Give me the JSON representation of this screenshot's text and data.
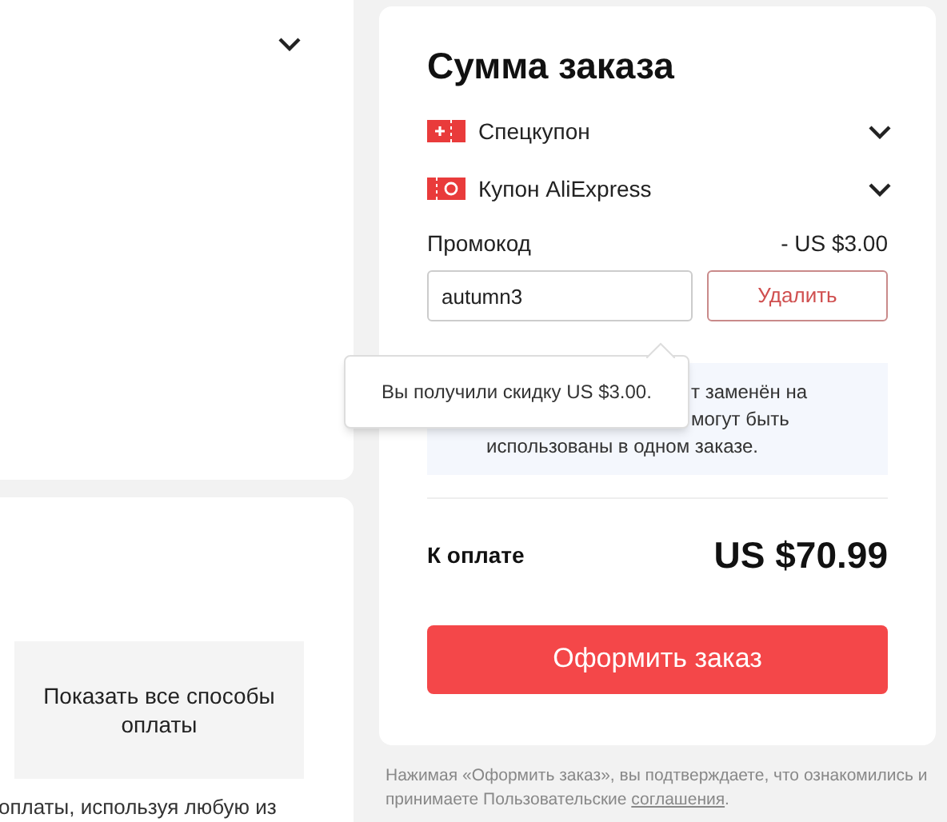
{
  "left_panel": {
    "show_payment_methods_button": "Показать все способы оплаты",
    "payment_note": "оплаты, используя любую из"
  },
  "order_summary": {
    "title": "Сумма заказа",
    "coupons": [
      {
        "kind": "special",
        "label": "Спецкупон"
      },
      {
        "kind": "store",
        "label": "Купон AliExpress"
      }
    ],
    "promo": {
      "label": "Промокод",
      "discount": "- US $3.00",
      "value": "autumn3",
      "remove_button": "Удалить"
    },
    "tooltip": "Вы получили скидку US $3.00.",
    "info_lines": [
      "т заменён на",
      "могут быть",
      "использованы в одном заказе."
    ],
    "total_label": "К оплате",
    "total": "US $70.99",
    "checkout_button": "Оформить заказ"
  },
  "footer": {
    "text": "Нажимая «Оформить заказ», вы подтверждаете, что ознакомились и принимаете Пользовательские ",
    "link": "соглашения",
    "after": "."
  }
}
